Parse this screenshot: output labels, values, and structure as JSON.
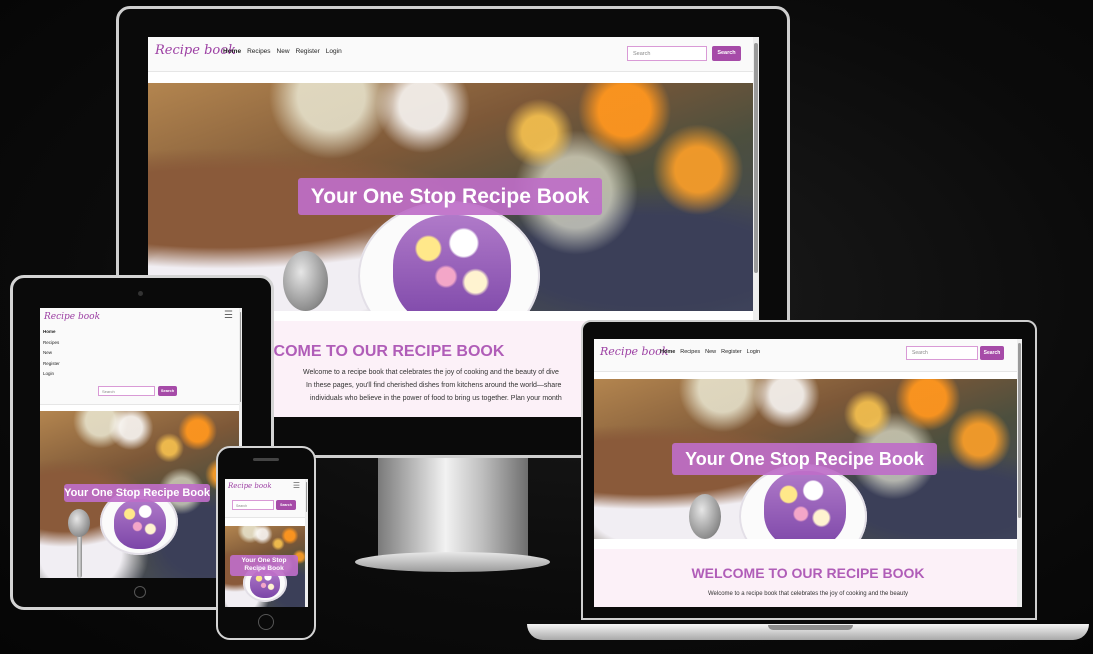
{
  "brand": {
    "logo": "Recipe book",
    "accent": "#a64ba8"
  },
  "nav": {
    "items": [
      "Home",
      "Recipes",
      "New",
      "Register",
      "Login"
    ],
    "active": "Home"
  },
  "search": {
    "placeholder": "Search",
    "button": "Search"
  },
  "hero": {
    "title": "Your One Stop Recipe Book"
  },
  "mobile_hero": {
    "line1": "Your One Stop",
    "line2": "Recipe Book"
  },
  "welcome": {
    "title": "WELCOME TO OUR RECIPE BOOK",
    "desktop_paragraph": "Welcome to a recipe book that celebrates the joy of cooking and the beauty of dive",
    "desktop_paragraph_2": "In these pages, you'll find cherished dishes from kitchens around the world—share",
    "desktop_paragraph_3": "individuals who believe in the power of food to bring us together. Plan your month",
    "laptop_paragraph": "Welcome to a recipe book that celebrates the joy of cooking and the beauty"
  },
  "icons": {
    "menu": "hamburger-icon"
  }
}
